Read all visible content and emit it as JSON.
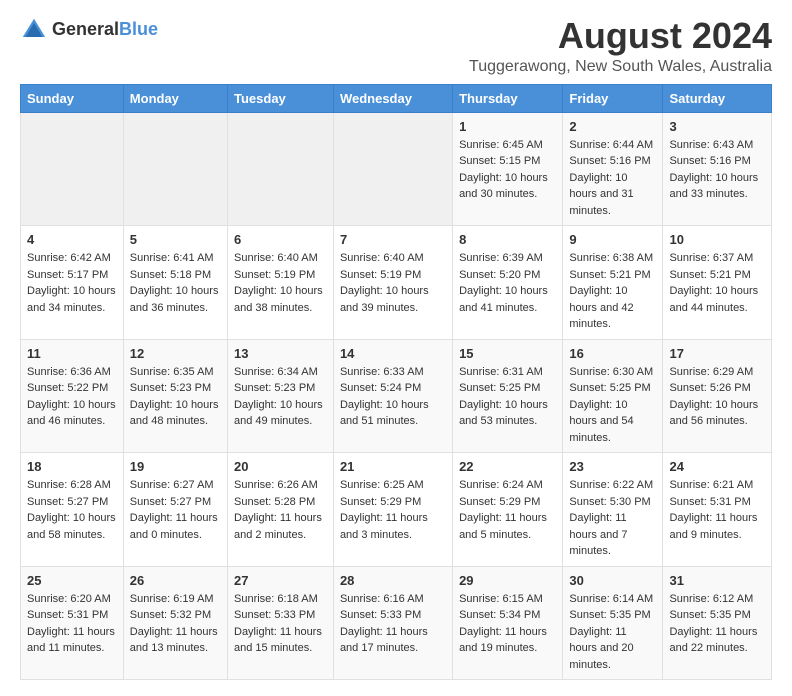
{
  "logo": {
    "line1": "General",
    "line2": "Blue"
  },
  "title": "August 2024",
  "subtitle": "Tuggerawong, New South Wales, Australia",
  "days_of_week": [
    "Sunday",
    "Monday",
    "Tuesday",
    "Wednesday",
    "Thursday",
    "Friday",
    "Saturday"
  ],
  "weeks": [
    [
      {
        "day": "",
        "sunrise": "",
        "sunset": "",
        "daylight": ""
      },
      {
        "day": "",
        "sunrise": "",
        "sunset": "",
        "daylight": ""
      },
      {
        "day": "",
        "sunrise": "",
        "sunset": "",
        "daylight": ""
      },
      {
        "day": "",
        "sunrise": "",
        "sunset": "",
        "daylight": ""
      },
      {
        "day": "1",
        "sunrise": "Sunrise: 6:45 AM",
        "sunset": "Sunset: 5:15 PM",
        "daylight": "Daylight: 10 hours and 30 minutes."
      },
      {
        "day": "2",
        "sunrise": "Sunrise: 6:44 AM",
        "sunset": "Sunset: 5:16 PM",
        "daylight": "Daylight: 10 hours and 31 minutes."
      },
      {
        "day": "3",
        "sunrise": "Sunrise: 6:43 AM",
        "sunset": "Sunset: 5:16 PM",
        "daylight": "Daylight: 10 hours and 33 minutes."
      }
    ],
    [
      {
        "day": "4",
        "sunrise": "Sunrise: 6:42 AM",
        "sunset": "Sunset: 5:17 PM",
        "daylight": "Daylight: 10 hours and 34 minutes."
      },
      {
        "day": "5",
        "sunrise": "Sunrise: 6:41 AM",
        "sunset": "Sunset: 5:18 PM",
        "daylight": "Daylight: 10 hours and 36 minutes."
      },
      {
        "day": "6",
        "sunrise": "Sunrise: 6:40 AM",
        "sunset": "Sunset: 5:19 PM",
        "daylight": "Daylight: 10 hours and 38 minutes."
      },
      {
        "day": "7",
        "sunrise": "Sunrise: 6:40 AM",
        "sunset": "Sunset: 5:19 PM",
        "daylight": "Daylight: 10 hours and 39 minutes."
      },
      {
        "day": "8",
        "sunrise": "Sunrise: 6:39 AM",
        "sunset": "Sunset: 5:20 PM",
        "daylight": "Daylight: 10 hours and 41 minutes."
      },
      {
        "day": "9",
        "sunrise": "Sunrise: 6:38 AM",
        "sunset": "Sunset: 5:21 PM",
        "daylight": "Daylight: 10 hours and 42 minutes."
      },
      {
        "day": "10",
        "sunrise": "Sunrise: 6:37 AM",
        "sunset": "Sunset: 5:21 PM",
        "daylight": "Daylight: 10 hours and 44 minutes."
      }
    ],
    [
      {
        "day": "11",
        "sunrise": "Sunrise: 6:36 AM",
        "sunset": "Sunset: 5:22 PM",
        "daylight": "Daylight: 10 hours and 46 minutes."
      },
      {
        "day": "12",
        "sunrise": "Sunrise: 6:35 AM",
        "sunset": "Sunset: 5:23 PM",
        "daylight": "Daylight: 10 hours and 48 minutes."
      },
      {
        "day": "13",
        "sunrise": "Sunrise: 6:34 AM",
        "sunset": "Sunset: 5:23 PM",
        "daylight": "Daylight: 10 hours and 49 minutes."
      },
      {
        "day": "14",
        "sunrise": "Sunrise: 6:33 AM",
        "sunset": "Sunset: 5:24 PM",
        "daylight": "Daylight: 10 hours and 51 minutes."
      },
      {
        "day": "15",
        "sunrise": "Sunrise: 6:31 AM",
        "sunset": "Sunset: 5:25 PM",
        "daylight": "Daylight: 10 hours and 53 minutes."
      },
      {
        "day": "16",
        "sunrise": "Sunrise: 6:30 AM",
        "sunset": "Sunset: 5:25 PM",
        "daylight": "Daylight: 10 hours and 54 minutes."
      },
      {
        "day": "17",
        "sunrise": "Sunrise: 6:29 AM",
        "sunset": "Sunset: 5:26 PM",
        "daylight": "Daylight: 10 hours and 56 minutes."
      }
    ],
    [
      {
        "day": "18",
        "sunrise": "Sunrise: 6:28 AM",
        "sunset": "Sunset: 5:27 PM",
        "daylight": "Daylight: 10 hours and 58 minutes."
      },
      {
        "day": "19",
        "sunrise": "Sunrise: 6:27 AM",
        "sunset": "Sunset: 5:27 PM",
        "daylight": "Daylight: 11 hours and 0 minutes."
      },
      {
        "day": "20",
        "sunrise": "Sunrise: 6:26 AM",
        "sunset": "Sunset: 5:28 PM",
        "daylight": "Daylight: 11 hours and 2 minutes."
      },
      {
        "day": "21",
        "sunrise": "Sunrise: 6:25 AM",
        "sunset": "Sunset: 5:29 PM",
        "daylight": "Daylight: 11 hours and 3 minutes."
      },
      {
        "day": "22",
        "sunrise": "Sunrise: 6:24 AM",
        "sunset": "Sunset: 5:29 PM",
        "daylight": "Daylight: 11 hours and 5 minutes."
      },
      {
        "day": "23",
        "sunrise": "Sunrise: 6:22 AM",
        "sunset": "Sunset: 5:30 PM",
        "daylight": "Daylight: 11 hours and 7 minutes."
      },
      {
        "day": "24",
        "sunrise": "Sunrise: 6:21 AM",
        "sunset": "Sunset: 5:31 PM",
        "daylight": "Daylight: 11 hours and 9 minutes."
      }
    ],
    [
      {
        "day": "25",
        "sunrise": "Sunrise: 6:20 AM",
        "sunset": "Sunset: 5:31 PM",
        "daylight": "Daylight: 11 hours and 11 minutes."
      },
      {
        "day": "26",
        "sunrise": "Sunrise: 6:19 AM",
        "sunset": "Sunset: 5:32 PM",
        "daylight": "Daylight: 11 hours and 13 minutes."
      },
      {
        "day": "27",
        "sunrise": "Sunrise: 6:18 AM",
        "sunset": "Sunset: 5:33 PM",
        "daylight": "Daylight: 11 hours and 15 minutes."
      },
      {
        "day": "28",
        "sunrise": "Sunrise: 6:16 AM",
        "sunset": "Sunset: 5:33 PM",
        "daylight": "Daylight: 11 hours and 17 minutes."
      },
      {
        "day": "29",
        "sunrise": "Sunrise: 6:15 AM",
        "sunset": "Sunset: 5:34 PM",
        "daylight": "Daylight: 11 hours and 19 minutes."
      },
      {
        "day": "30",
        "sunrise": "Sunrise: 6:14 AM",
        "sunset": "Sunset: 5:35 PM",
        "daylight": "Daylight: 11 hours and 20 minutes."
      },
      {
        "day": "31",
        "sunrise": "Sunrise: 6:12 AM",
        "sunset": "Sunset: 5:35 PM",
        "daylight": "Daylight: 11 hours and 22 minutes."
      }
    ]
  ]
}
